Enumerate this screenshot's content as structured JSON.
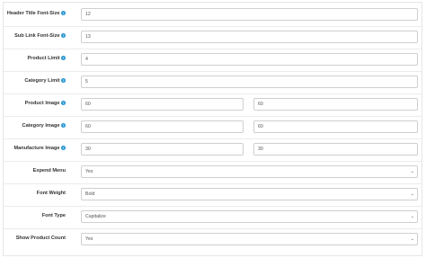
{
  "rows": [
    {
      "label": "Header Title Font-Size",
      "value": "12"
    },
    {
      "label": "Sub Link Font-Size",
      "value": "13"
    },
    {
      "label": "Product Limit",
      "value": "4"
    },
    {
      "label": "Category Limit",
      "value": "5"
    },
    {
      "label": "Product Image",
      "value1": "60",
      "value2": "60"
    },
    {
      "label": "Category Image",
      "value1": "60",
      "value2": "60"
    },
    {
      "label": "Manufacture Image",
      "value1": "30",
      "value2": "30"
    },
    {
      "label": "Expend Menu",
      "value": "Yes"
    },
    {
      "label": "Font Weight",
      "value": "Bold"
    },
    {
      "label": "Font Type",
      "value": "Capitalize"
    },
    {
      "label": "Show Product Count",
      "value": "Yes"
    }
  ],
  "help_icon": "question-circle-icon",
  "colors": {
    "help": "#1e91cf",
    "border": "#cfcfcf"
  }
}
